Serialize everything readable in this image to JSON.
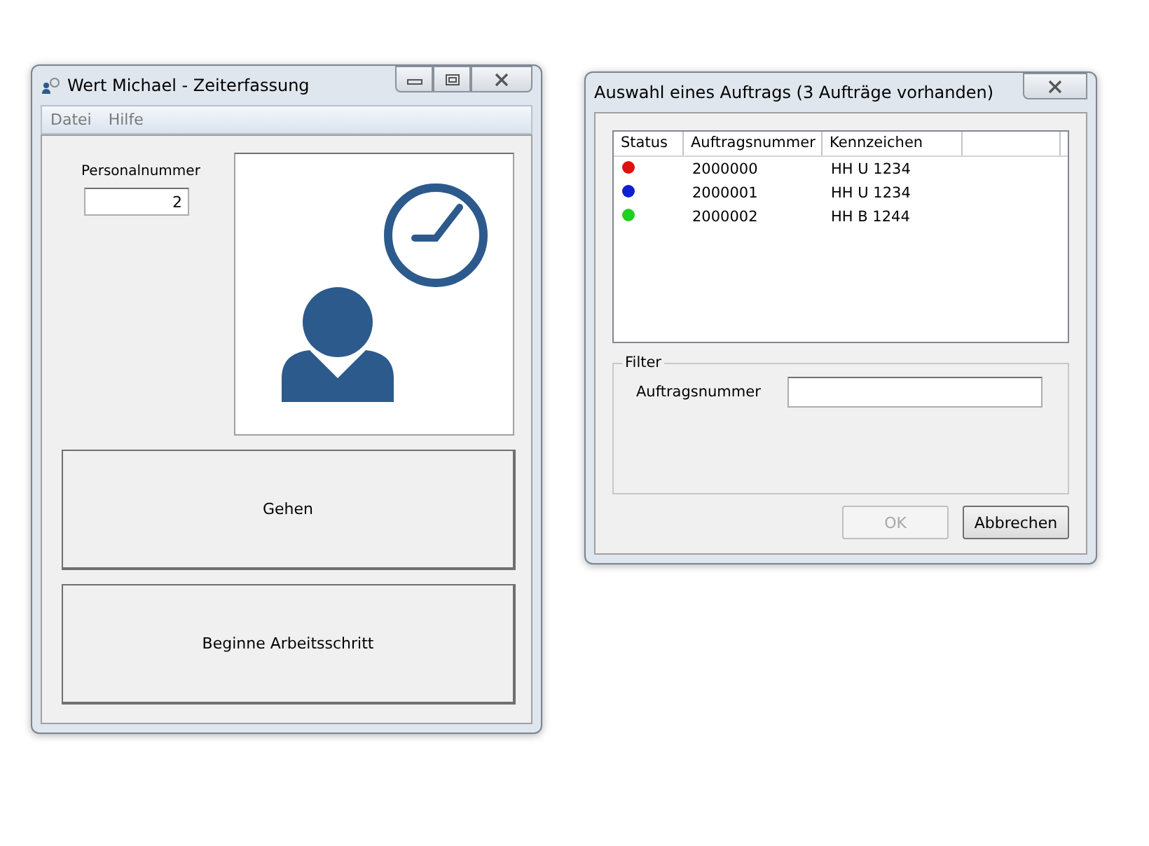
{
  "main_window": {
    "title": "Wert Michael - Zeiterfassung",
    "menu": [
      "Datei",
      "Hilfe"
    ],
    "personalnummer": {
      "label": "Personalnummer",
      "value": "2"
    },
    "buttons": [
      "Gehen",
      "Beginne Arbeitsschritt"
    ]
  },
  "dialog": {
    "title": "Auswahl eines Auftrags (3 Aufträge vorhanden)",
    "table": {
      "columns": [
        "Status",
        "Auftragsnummer",
        "Kennzeichen"
      ],
      "rows": [
        {
          "color": "#e01010",
          "auftragsnummer": "2000000",
          "kennzeichen": "HH U 1234"
        },
        {
          "color": "#1020d0",
          "auftragsnummer": "2000001",
          "kennzeichen": "HH U 1234"
        },
        {
          "color": "#20d020",
          "auftragsnummer": "2000002",
          "kennzeichen": "HH B 1244"
        }
      ]
    },
    "filter": {
      "title": "Filter",
      "label": "Auftragsnummer"
    },
    "buttons": [
      {
        "label": "OK",
        "disabled": true
      },
      {
        "label": "Abbrechen",
        "disabled": false
      }
    ]
  }
}
